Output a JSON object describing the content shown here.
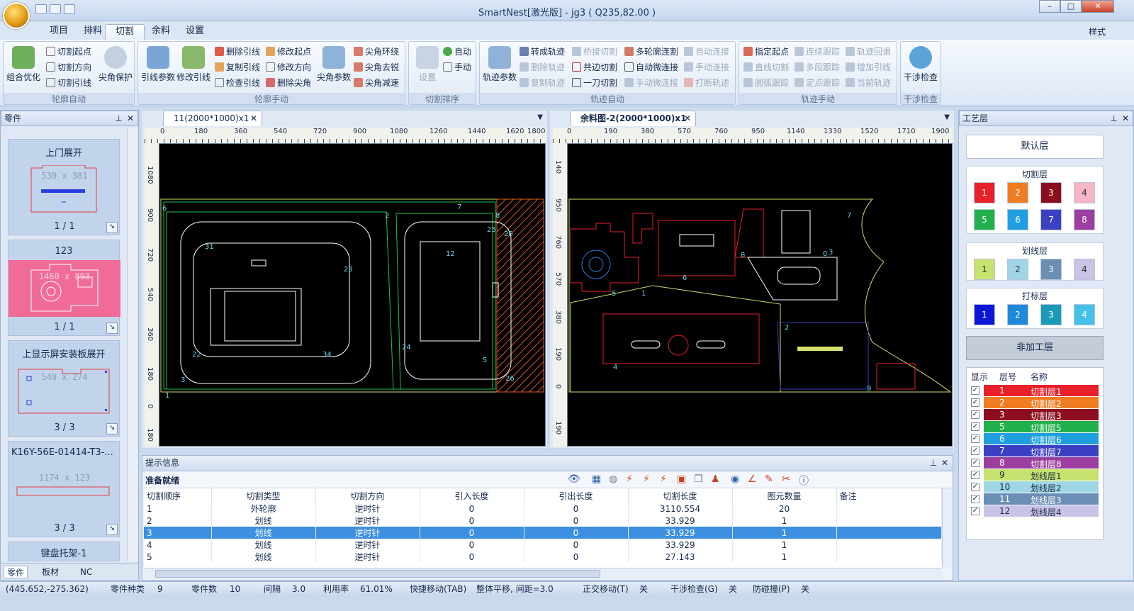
{
  "window": {
    "title": "SmartNest[激光版] - jg3 ( Q235,82.00 )"
  },
  "ribbon_tabs": [
    "项目",
    "排料",
    "切割",
    "余料",
    "设置"
  ],
  "style_label": "样式",
  "ribbon": {
    "g1": {
      "caption": "轮廓自动",
      "big": "组合优化",
      "items": [
        "切割起点",
        "切割方向",
        "切割引线"
      ],
      "big2": "尖角保护"
    },
    "g2": {
      "caption": "轮廓手动",
      "big1": "引线参数",
      "big2": "修改引线",
      "col1": [
        "删除引线",
        "复制引线",
        "检查引线"
      ],
      "col2": [
        "修改起点",
        "修改方向",
        "删除尖角"
      ],
      "big3": "尖角参数",
      "col3": [
        "尖角环绕",
        "尖角去锐",
        "尖角减速"
      ]
    },
    "g3": {
      "caption": "切割排序",
      "big": "设置",
      "items": [
        "自动",
        "手动"
      ]
    },
    "g4": {
      "caption": "轨迹自动",
      "big": "轨迹参数",
      "col1": [
        "转成轨迹",
        "删除轨迹",
        "复制轨迹"
      ],
      "col2": [
        "桥接切割",
        "共边切割",
        "一刀切割"
      ],
      "col3": [
        "多轮廓连割",
        "自动微连接",
        "手动微连接"
      ],
      "col4": [
        "自动连接",
        "手动连接",
        "打断轨迹"
      ]
    },
    "g5": {
      "caption": "轨迹手动",
      "col1": [
        "指定起点",
        "直线切割",
        "圆弧跟踪"
      ],
      "col2": [
        "连续跟踪",
        "多段跟踪",
        "定点跟踪"
      ],
      "col3": [
        "轨迹回退",
        "增加引线",
        "当前轨迹"
      ]
    },
    "g6": {
      "caption": "干涉检查",
      "big": "干涉检查"
    }
  },
  "left_panel": {
    "title": "零件",
    "parts": [
      {
        "name": "上门展开",
        "dim": "530 x 381",
        "count": "1 / 1"
      },
      {
        "name": "123",
        "dim": "1460 x 893",
        "count": "1 / 1"
      },
      {
        "name": "上显示屏安装板展开",
        "dim": "549 x 274",
        "count": "3 / 3"
      },
      {
        "name": "K16Y-56E-01414-T3-...",
        "dim": "1174 x 123",
        "count": "3 / 3"
      },
      {
        "name": "键盘托架-1",
        "dim": "",
        "count": ""
      }
    ],
    "bottom_tabs": [
      "零件",
      "板材",
      "NC"
    ]
  },
  "doc1": {
    "tab": "11(2000*1000)x1",
    "ruler_x": [
      "0",
      "180",
      "360",
      "540",
      "720",
      "900",
      "1080",
      "1260",
      "1440",
      "1620",
      "1800"
    ],
    "ruler_y": [
      "1080",
      "900",
      "720",
      "540",
      "360",
      "180",
      "0",
      "180"
    ]
  },
  "doc2": {
    "tab": "余料图-2(2000*1000)x1",
    "ruler_x": [
      "0",
      "190",
      "380",
      "570",
      "760",
      "950",
      "1140",
      "1330",
      "1520",
      "1710",
      "1900"
    ],
    "ruler_y": [
      "140",
      "950",
      "760",
      "570",
      "380",
      "190",
      "0",
      "190"
    ]
  },
  "hint": {
    "title": "提示信息",
    "status": "准备就绪",
    "columns": [
      "切割顺序",
      "切割类型",
      "切割方向",
      "引入长度",
      "引出长度",
      "切割长度",
      "图元数量",
      "备注"
    ],
    "rows": [
      [
        "1",
        "外轮廓",
        "逆时针",
        "0",
        "0",
        "3110.554",
        "20",
        ""
      ],
      [
        "2",
        "划线",
        "逆时针",
        "0",
        "0",
        "33.929",
        "1",
        ""
      ],
      [
        "3",
        "划线",
        "逆时针",
        "0",
        "0",
        "33.929",
        "1",
        ""
      ],
      [
        "4",
        "划线",
        "逆时针",
        "0",
        "0",
        "33.929",
        "1",
        ""
      ],
      [
        "5",
        "划线",
        "逆时针",
        "0",
        "0",
        "27.143",
        "1",
        ""
      ]
    ],
    "selected_row": 2
  },
  "right_panel": {
    "title": "工艺层",
    "default_layer": "默认层",
    "cut_title": "切割层",
    "cut": [
      {
        "n": "1",
        "c": "#e8202a"
      },
      {
        "n": "2",
        "c": "#f07d22"
      },
      {
        "n": "3",
        "c": "#8c0d1e"
      },
      {
        "n": "4",
        "c": "#f7b6c8"
      },
      {
        "n": "5",
        "c": "#21b04b"
      },
      {
        "n": "6",
        "c": "#1f9fe0"
      },
      {
        "n": "7",
        "c": "#3b3fc2"
      },
      {
        "n": "8",
        "c": "#9b3e9f"
      }
    ],
    "mark_title": "划线层",
    "mark": [
      {
        "n": "1",
        "c": "#c7e26e"
      },
      {
        "n": "2",
        "c": "#9fd6e6"
      },
      {
        "n": "3",
        "c": "#6b8fb4"
      },
      {
        "n": "4",
        "c": "#c9c3e5"
      }
    ],
    "stamp_title": "打标层",
    "stamp": [
      {
        "n": "1",
        "c": "#0b16d6"
      },
      {
        "n": "2",
        "c": "#1f88d9"
      },
      {
        "n": "3",
        "c": "#1b9ab8"
      },
      {
        "n": "4",
        "c": "#46c0e8"
      }
    ],
    "noproc": "非加工层",
    "list_headers": [
      "显示",
      "层号",
      "名称"
    ],
    "list": [
      {
        "n": "1",
        "name": "切割层1",
        "c": "#e8202a"
      },
      {
        "n": "2",
        "name": "切割层2",
        "c": "#f07d22"
      },
      {
        "n": "3",
        "name": "切割层3",
        "c": "#8c0d1e"
      },
      {
        "n": "5",
        "name": "切割层5",
        "c": "#21b04b"
      },
      {
        "n": "6",
        "name": "切割层6",
        "c": "#1f9fe0"
      },
      {
        "n": "7",
        "name": "切割层7",
        "c": "#3b3fc2"
      },
      {
        "n": "8",
        "name": "切割层8",
        "c": "#9b3e9f"
      },
      {
        "n": "9",
        "name": "划线层1",
        "c": "#c7e26e"
      },
      {
        "n": "10",
        "name": "划线层2",
        "c": "#9fd6e6"
      },
      {
        "n": "11",
        "name": "划线层3",
        "c": "#6b8fb4"
      },
      {
        "n": "12",
        "name": "划线层4",
        "c": "#c9c3e5"
      }
    ]
  },
  "statusbar": {
    "coord": "(445.652,-275.362)",
    "kinds_label": "零件种类",
    "kinds": "9",
    "count_label": "零件数",
    "count": "10",
    "gap_label": "间隔",
    "gap": "3.0",
    "util_label": "利用率",
    "util": "61.01%",
    "fast": "快捷移动(TAB)",
    "shift": "整体平移, 间距=3.0",
    "ortho": "正交移动(T)",
    "ortho_v": "关",
    "interf": "干涉检查(G)",
    "interf_v": "关",
    "collide": "防碰撞(P)",
    "collide_v": "关"
  }
}
